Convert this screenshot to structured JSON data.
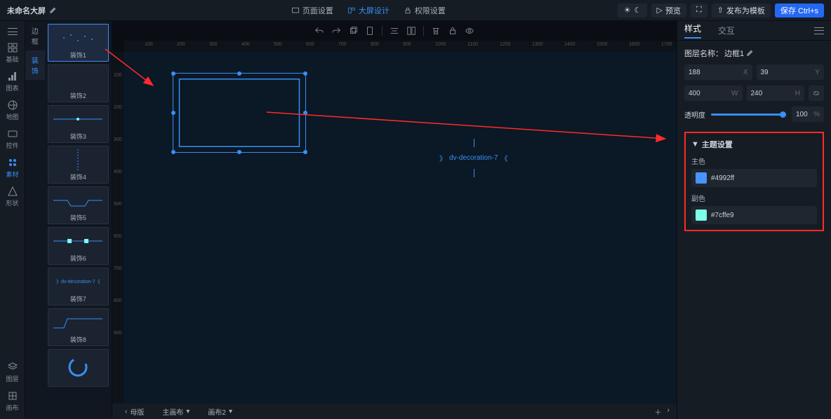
{
  "title": "未命名大屏",
  "tabs": {
    "page": "页面设置",
    "design": "大屏设计",
    "perm": "权限设置"
  },
  "top": {
    "preview": "预览",
    "publish": "发布为模板",
    "save": "保存 Ctrl+s"
  },
  "nav": {
    "top": [
      {
        "id": "basic",
        "label": "基础"
      },
      {
        "id": "chart",
        "label": "图表"
      },
      {
        "id": "map",
        "label": "地图"
      },
      {
        "id": "ctrl",
        "label": "控件"
      },
      {
        "id": "asset",
        "label": "素材",
        "active": true
      },
      {
        "id": "shape",
        "label": "形状"
      }
    ],
    "bottom": [
      {
        "id": "layer",
        "label": "图层"
      },
      {
        "id": "canvas",
        "label": "画布"
      }
    ]
  },
  "assetTabs": {
    "a": "边框",
    "b": "装饰"
  },
  "thumbs": [
    "装饰1",
    "装饰2",
    "装饰3",
    "装饰4",
    "装饰5",
    "装饰6",
    "装饰7",
    "装饰8",
    ""
  ],
  "footer": {
    "a": "母版",
    "b": "主画布",
    "c": "画布2"
  },
  "canvas": {
    "decoLabel": "dv-decoration-7"
  },
  "ruler": [
    "100",
    "200",
    "300",
    "400",
    "500",
    "600",
    "700",
    "800",
    "900",
    "1000",
    "1100",
    "1200",
    "1300",
    "1400",
    "1500",
    "1600",
    "1700"
  ],
  "rulerV": [
    "100",
    "200",
    "300",
    "400",
    "500",
    "600",
    "700",
    "800",
    "900"
  ],
  "insp": {
    "tabs": {
      "style": "样式",
      "inter": "交互"
    },
    "layerLabel": "图层名称：",
    "layerName": "边框1",
    "x": "188",
    "xL": "X",
    "y": "39",
    "yL": "Y",
    "w": "400",
    "wL": "W",
    "h": "240",
    "hL": "H",
    "opacityLabel": "透明度",
    "opacityVal": "100",
    "opacityUnit": "%",
    "theme": {
      "hdr": "主题设置",
      "main": "主色",
      "mainHex": "#4992ff",
      "sub": "副色",
      "subHex": "#7cffe9"
    }
  }
}
